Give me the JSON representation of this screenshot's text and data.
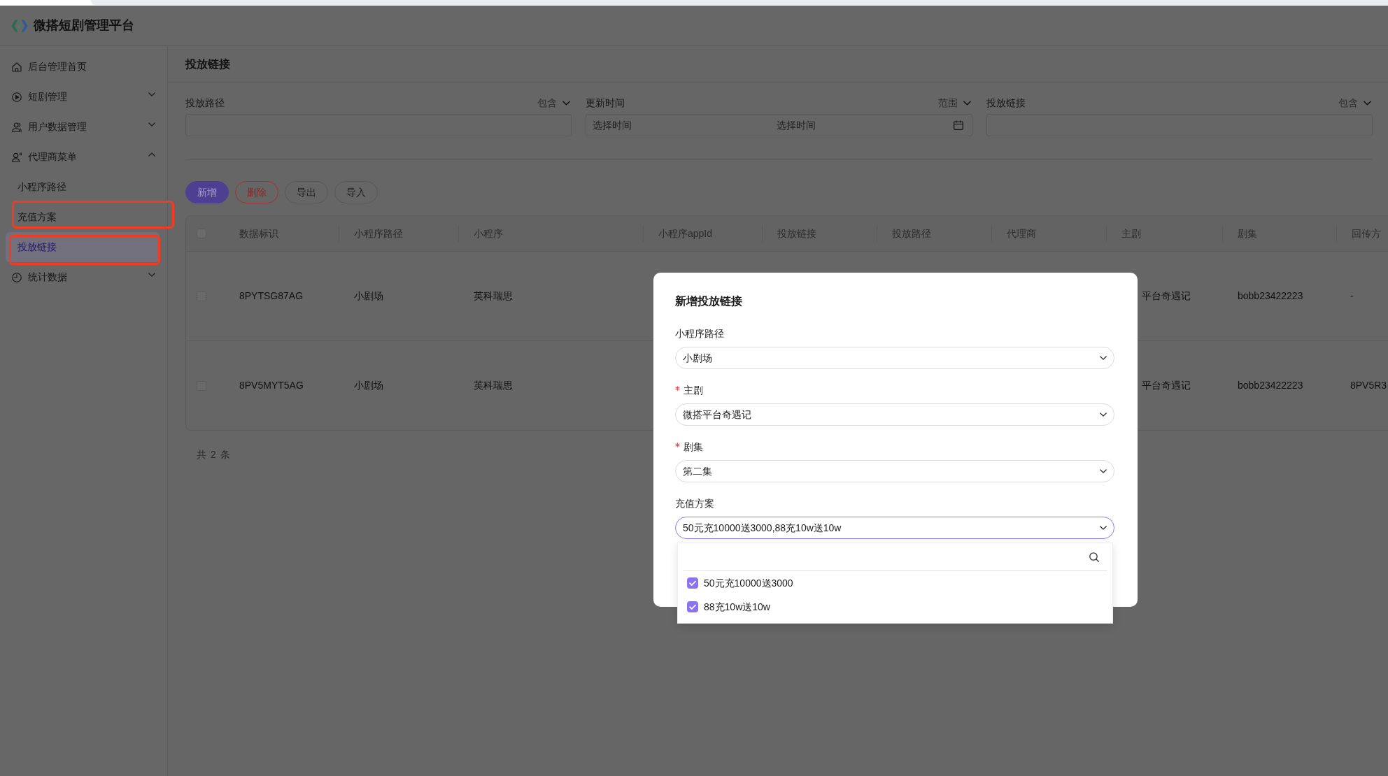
{
  "app": {
    "title": "微搭短剧管理平台"
  },
  "sidebar": {
    "items": [
      {
        "label": "后台管理首页",
        "selected": false
      },
      {
        "label": "短剧管理",
        "selected": false,
        "expanded": false
      },
      {
        "label": "用户数据管理",
        "selected": false,
        "expanded": false
      },
      {
        "label": "代理商菜单",
        "selected": false,
        "expanded": true,
        "children": [
          {
            "label": "小程序路径",
            "selected": false,
            "annotated": false
          },
          {
            "label": "充值方案",
            "selected": false,
            "annotated": true
          },
          {
            "label": "投放链接",
            "selected": true,
            "annotated": true
          }
        ]
      },
      {
        "label": "统计数据",
        "selected": false,
        "expanded": false
      }
    ]
  },
  "page": {
    "title": "投放链接"
  },
  "filters": [
    {
      "label": "投放路径",
      "operator": "包含",
      "kind": "text"
    },
    {
      "label": "更新时间",
      "operator": "范围",
      "kind": "date_range",
      "placeholders": [
        "选择时间",
        "选择时间"
      ]
    },
    {
      "label": "投放链接",
      "operator": "包含",
      "kind": "text"
    }
  ],
  "toolbar": [
    {
      "label": "新增",
      "kind": "primary"
    },
    {
      "label": "删除",
      "kind": "danger"
    },
    {
      "label": "导出",
      "kind": "default"
    },
    {
      "label": "导入",
      "kind": "default"
    }
  ],
  "table": {
    "header_checked": false,
    "columns": [
      "数据标识",
      "小程序路径",
      "小程序",
      "小程序appId",
      "投放链接",
      "投放路径",
      "代理商",
      "主剧",
      "剧集",
      "回传方"
    ],
    "rows": [
      {
        "checked": false,
        "data_id": "8PYTSG87AG",
        "mini_program_path": "小剧场",
        "mini_program": "英科瑞思",
        "main_drama": "平台奇遇记",
        "episode": "bobb23422223",
        "column_10": "-"
      },
      {
        "checked": false,
        "data_id": "8PV5MYT5AG",
        "mini_program_path": "小剧场",
        "mini_program": "英科瑞思",
        "main_drama": "平台奇遇记",
        "episode": "bobb23422223",
        "column_10": "8PV5R3"
      }
    ]
  },
  "total": "共 2 条",
  "modal": {
    "title": "新增投放链接",
    "fields": [
      {
        "label": "小程序路径",
        "required": false,
        "value": "小剧场",
        "expanded": false
      },
      {
        "label": "主剧",
        "required": true,
        "value": "微搭平台奇遇记",
        "expanded": false
      },
      {
        "label": "剧集",
        "required": true,
        "value": "第二集",
        "expanded": false
      },
      {
        "label": "充值方案",
        "required": false,
        "value": "50元充10000送3000,88充10w送10w",
        "expanded": true,
        "options": [
          {
            "label": "50元充10000送3000",
            "checked": true
          },
          {
            "label": "88充10w送10w",
            "checked": true
          }
        ]
      }
    ]
  }
}
